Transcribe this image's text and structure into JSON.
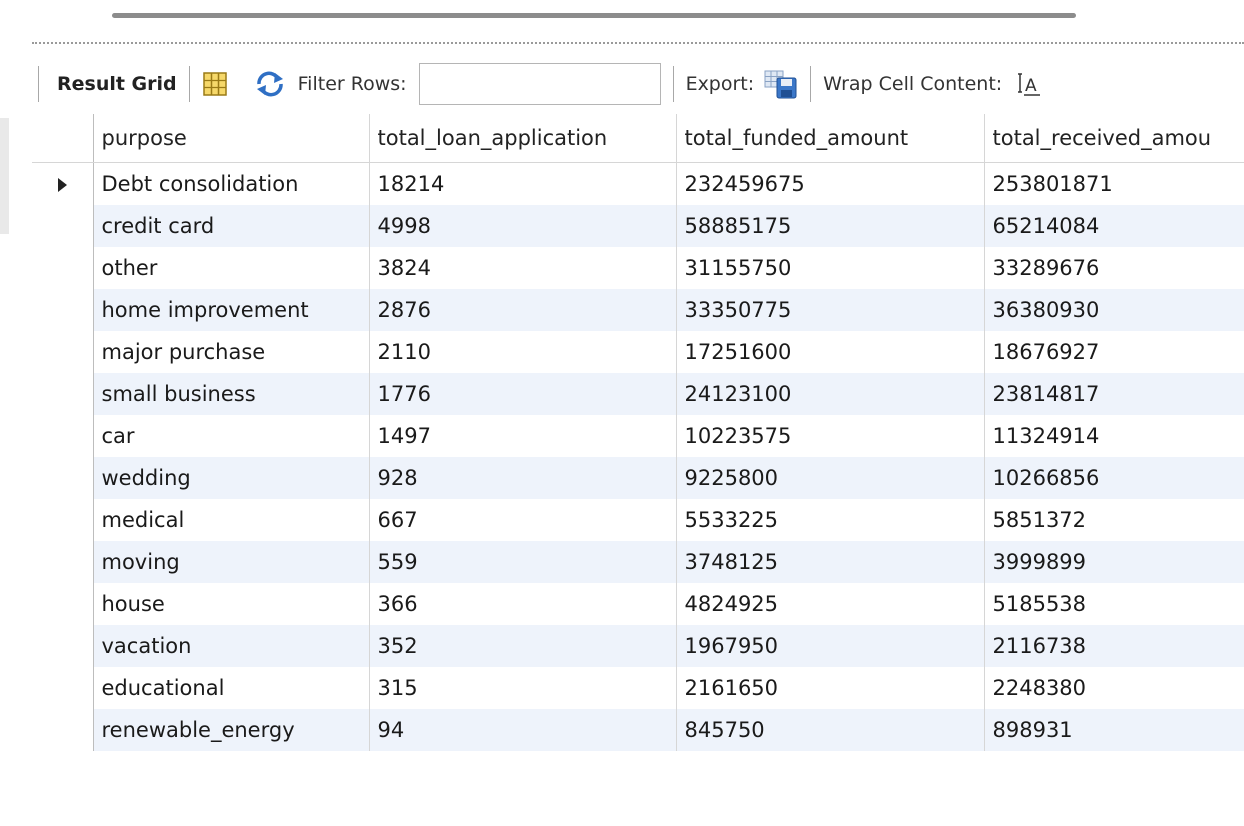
{
  "toolbar": {
    "result_grid_label": "Result Grid",
    "filter_label": "Filter Rows:",
    "filter_value": "",
    "export_label": "Export:",
    "wrap_label": "Wrap Cell Content:",
    "icons": [
      "grid-form-icon",
      "refresh-icon",
      "export-icon",
      "wrap-cell-icon"
    ]
  },
  "grid": {
    "columns": [
      "purpose",
      "total_loan_application",
      "total_funded_amount",
      "total_received_amou"
    ],
    "rows": [
      [
        "Debt consolidation",
        "18214",
        "232459675",
        "253801871"
      ],
      [
        "credit card",
        "4998",
        "58885175",
        "65214084"
      ],
      [
        "other",
        "3824",
        "31155750",
        "33289676"
      ],
      [
        "home improvement",
        "2876",
        "33350775",
        "36380930"
      ],
      [
        "major purchase",
        "2110",
        "17251600",
        "18676927"
      ],
      [
        "small business",
        "1776",
        "24123100",
        "23814817"
      ],
      [
        "car",
        "1497",
        "10223575",
        "11324914"
      ],
      [
        "wedding",
        "928",
        "9225800",
        "10266856"
      ],
      [
        "medical",
        "667",
        "5533225",
        "5851372"
      ],
      [
        "moving",
        "559",
        "3748125",
        "3999899"
      ],
      [
        "house",
        "366",
        "4824925",
        "5185538"
      ],
      [
        "vacation",
        "352",
        "1967950",
        "2116738"
      ],
      [
        "educational",
        "315",
        "2161650",
        "2248380"
      ],
      [
        "renewable_energy",
        "94",
        "845750",
        "898931"
      ]
    ],
    "selected_row": 0
  }
}
